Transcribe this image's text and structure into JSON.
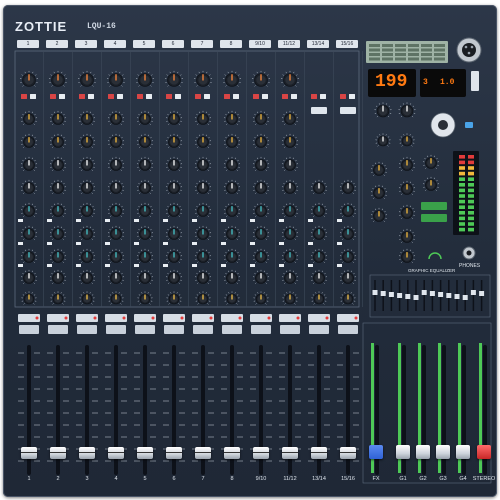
{
  "brand": "ZOTTIE",
  "model": "LQU-16",
  "channels": [
    "1",
    "2",
    "3",
    "4",
    "5",
    "6",
    "7",
    "8",
    "9/10",
    "11/12",
    "13/14",
    "15/16"
  ],
  "channel_faders": [
    "1",
    "2",
    "3",
    "4",
    "5",
    "6",
    "7",
    "8",
    "9/10",
    "11/12",
    "13/14",
    "15/16"
  ],
  "master_faders": [
    "FX",
    "G1",
    "G2",
    "G3",
    "G4",
    "STEREO"
  ],
  "display": {
    "preset": "199",
    "small_left": "3",
    "small_right": "1.0"
  },
  "section_labels": {
    "graphic_eq": "GRAPHIC EQUALIZER",
    "phones": "PHONES"
  },
  "green_buttons": [
    "",
    ""
  ],
  "colors": {
    "panel": "#28323f",
    "display_orange": "#ff7a12",
    "fx_blue": "#2f62d6",
    "stereo_red": "#e23b3b",
    "meter_green": "#4ec957"
  }
}
